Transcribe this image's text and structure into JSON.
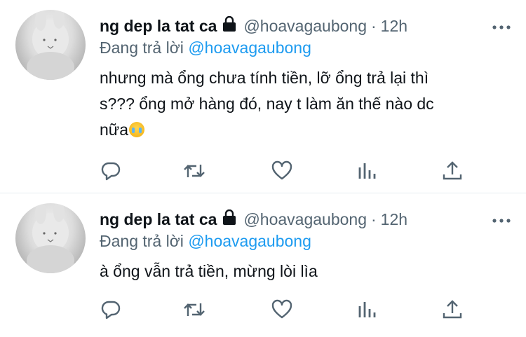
{
  "tweets": [
    {
      "author_name": "ng dep la tat ca",
      "handle": "@hoavagaubong",
      "separator": "·",
      "time": "12h",
      "reply_prefix": "Đang trả lời",
      "reply_to": "@hoavagaubong",
      "text_line1": "nhưng mà ổng chưa tính tiền, lỡ ổng trả lại thì",
      "text_line2": "s??? ổng mở hàng đó, nay t làm ăn thế nào dc",
      "text_line3": "nữa",
      "emoji": "crying-face"
    },
    {
      "author_name": "ng dep la tat ca",
      "handle": "@hoavagaubong",
      "separator": "·",
      "time": "12h",
      "reply_prefix": "Đang trả lời",
      "reply_to": "@hoavagaubong",
      "text_line1": "à ổng vẫn trả tiền, mừng lòi lìa"
    }
  ],
  "actions": [
    "reply-icon",
    "retweet-icon",
    "like-icon",
    "analytics-icon",
    "share-icon"
  ],
  "colors": {
    "link": "#1d9bf0",
    "secondary": "#536471",
    "divider": "#e6ecf0"
  }
}
